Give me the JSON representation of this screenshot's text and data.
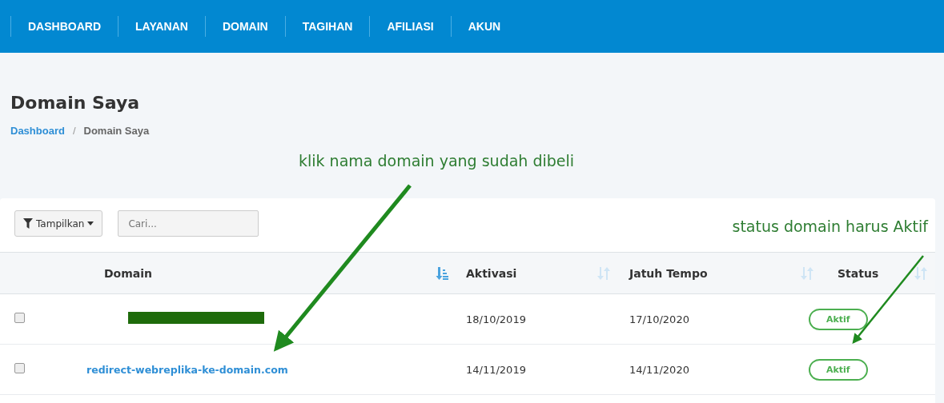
{
  "nav": {
    "items": [
      {
        "label": "DASHBOARD"
      },
      {
        "label": "LAYANAN"
      },
      {
        "label": "DOMAIN"
      },
      {
        "label": "TAGIHAN"
      },
      {
        "label": "AFILIASI"
      },
      {
        "label": "AKUN"
      }
    ]
  },
  "page": {
    "title": "Domain Saya",
    "breadcrumb": [
      {
        "label": "Dashboard",
        "kind": "link"
      },
      {
        "label": "/",
        "kind": "separator"
      },
      {
        "label": "Domain Saya",
        "kind": "current"
      }
    ]
  },
  "toolbar": {
    "filter_button": "Tampilkan",
    "search": {
      "placeholder": "Cari..."
    }
  },
  "table": {
    "columns": [
      {
        "label": "Domain",
        "sorted": true
      },
      {
        "label": "Aktivasi",
        "sorted": false
      },
      {
        "label": "Jatuh Tempo",
        "sorted": false
      },
      {
        "label": "Status",
        "sorted": false
      }
    ],
    "rows": [
      {
        "checked": false,
        "redacted": true,
        "activation": "18/10/2019",
        "due": "17/10/2020",
        "status": "Aktif"
      },
      {
        "checked": false,
        "redacted": false,
        "domain": "redirect-webreplika-ke-domain.com",
        "activation": "14/11/2019",
        "due": "14/11/2020",
        "status": "Aktif"
      }
    ]
  },
  "annotations": [
    {
      "text": "klik nama domain yang sudah dibeli"
    },
    {
      "text": "status domain harus Aktif"
    }
  ]
}
